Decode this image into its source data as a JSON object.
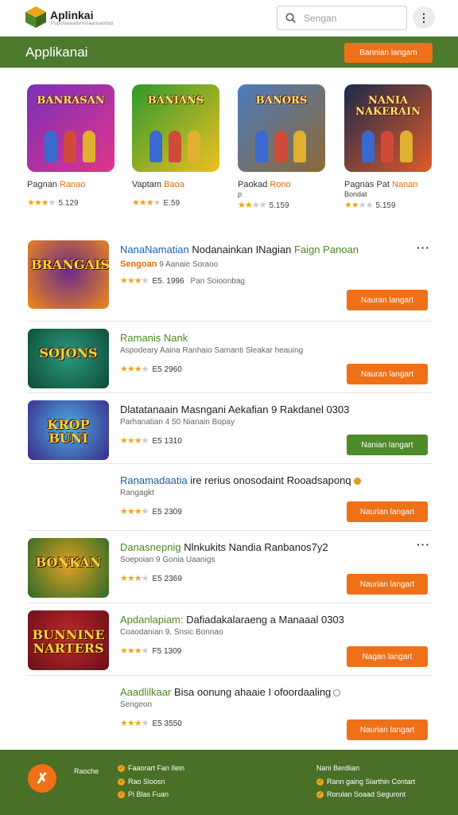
{
  "header": {
    "brand": "Aplinkai",
    "brand_sub": "Pupuhaiaadvntisaarisamtas",
    "search_placeholder": "Sengan"
  },
  "section": {
    "title": "Applikanai",
    "action_label": "Bannian langam"
  },
  "featured": [
    {
      "name": "Pagnan",
      "name_accent": "Ranao",
      "rating": "5.129",
      "stars": 3,
      "art_text": "BANRASAN",
      "colors": [
        "#7b2fb8",
        "#e0358a"
      ]
    },
    {
      "name": "Vaptam",
      "name_accent": "Baoa",
      "rating": "E.59",
      "stars": 3,
      "art_text": "BANIANS",
      "colors": [
        "#2e9a2e",
        "#f0c020"
      ]
    },
    {
      "name": "Paokad",
      "name_accent": "Rono",
      "name_sub": "p",
      "rating": "5.159",
      "stars": 2,
      "art_text": "BANORS",
      "colors": [
        "#4e7bbf",
        "#8c6a35"
      ]
    },
    {
      "name": "Pagnas Pat",
      "name_accent": "Nanan",
      "name_sub": "Bondat",
      "rating": "5.159",
      "stars": 2,
      "art_text": "NANIA NAKERAIN",
      "colors": [
        "#1b2a4a",
        "#e05a2a"
      ]
    }
  ],
  "apps": [
    {
      "title_a": "NanaNamatian",
      "title_b": "Nodanainkan INagian",
      "title_c": "Faign",
      "title_d": "Panoan",
      "sub_a": "Sengoan",
      "sub_b": "9 Aanaie Soraoo",
      "rating": "E5. 1996",
      "extra": "Pan Soioonbag",
      "stars": 3,
      "button": "Nauran langart",
      "button_style": "orange",
      "thumb_text": "BRANGAIS",
      "colors": [
        "#f08a1a",
        "#6a2a8a"
      ],
      "show_more": true
    },
    {
      "title_a": "",
      "title_b": "",
      "title_c": "Ramanis Nank",
      "title_d": "",
      "sub_a": "",
      "sub_b": "Aspodeary Aaina Ranhaio Samanti Sleakar heauing",
      "rating": "E5 2960",
      "extra": "",
      "stars": 3,
      "button": "Nauran langart",
      "button_style": "orange",
      "thumb_text": "SOJONS",
      "colors": [
        "#0e4a3a",
        "#2a9a7a"
      ],
      "show_more": false
    },
    {
      "title_a": "",
      "title_b": "Dlatatanaain Masngani Aekafian 9 Rakdanel 0303",
      "title_c": "",
      "title_d": "",
      "sub_a": "",
      "sub_b": "Parhanatian 4 50 Nianain Bopay",
      "rating": "E5 1310",
      "extra": "",
      "stars": 3,
      "button": "Nanian langart",
      "button_style": "green",
      "thumb_text": "KROP BUNI",
      "colors": [
        "#3a2a8a",
        "#4ab0e0"
      ],
      "show_more": false
    },
    {
      "title_a": "Ranamadaatia",
      "title_b": "ire rerius onosodaint Rooadsaponq",
      "title_c": "",
      "title_d": "",
      "sub_a": "",
      "sub_b": "Rangagkt",
      "rating": "E5 2309",
      "extra": "",
      "stars": 3,
      "button": "Naurian langart",
      "button_style": "orange",
      "thumb_text": "",
      "colors": [],
      "show_more": false,
      "dot": "orange"
    },
    {
      "title_a": "",
      "title_b": "Nlnkukits Nandia Ranbanos7y2",
      "title_c": "Danasnepnig",
      "title_d": "",
      "sub_a": "",
      "sub_b": "Soepoian 9 Gonia Uaanigs",
      "rating": "E5 2369",
      "extra": "",
      "stars": 3,
      "button": "Naurian langart",
      "button_style": "orange",
      "thumb_text": "BONKAN",
      "colors": [
        "#2a6a2a",
        "#e0a020"
      ],
      "show_more": true
    },
    {
      "title_a": "",
      "title_b": "Dafiadakalaraeng a Manaaal 0303",
      "title_c": "Apdanlapiam:",
      "title_d": "",
      "sub_a": "",
      "sub_b": "Coaodanian 9, Snsic Bonnao",
      "rating": "F5 1309",
      "extra": "",
      "stars": 3,
      "button": "Nagan langart",
      "button_style": "orange",
      "thumb_text": "BUNNINE NARTERS",
      "colors": [
        "#6a0e1a",
        "#c02a2a"
      ],
      "show_more": false
    },
    {
      "title_a": "",
      "title_b": "Bisa oonung ahaaie I ofoordaaling",
      "title_c": "Aaadlilkaar",
      "title_d": "",
      "sub_a": "",
      "sub_b": "Sengeon",
      "rating": "E5 3550",
      "extra": "",
      "stars": 3,
      "button": "Naurian langart",
      "button_style": "orange",
      "thumb_text": "",
      "colors": [],
      "show_more": false,
      "dot": "grey"
    }
  ],
  "footer": {
    "col1_title": "Raoche",
    "col1_links": [
      "Faaorart Fan Ilein",
      "Rao Sloosn",
      "Pi Blas Fuan"
    ],
    "col2_title": "Nani Berdiian",
    "col2_links": [
      "Rann gaing Siarthin Contart",
      "Rorulan Soaad Seguront"
    ]
  }
}
